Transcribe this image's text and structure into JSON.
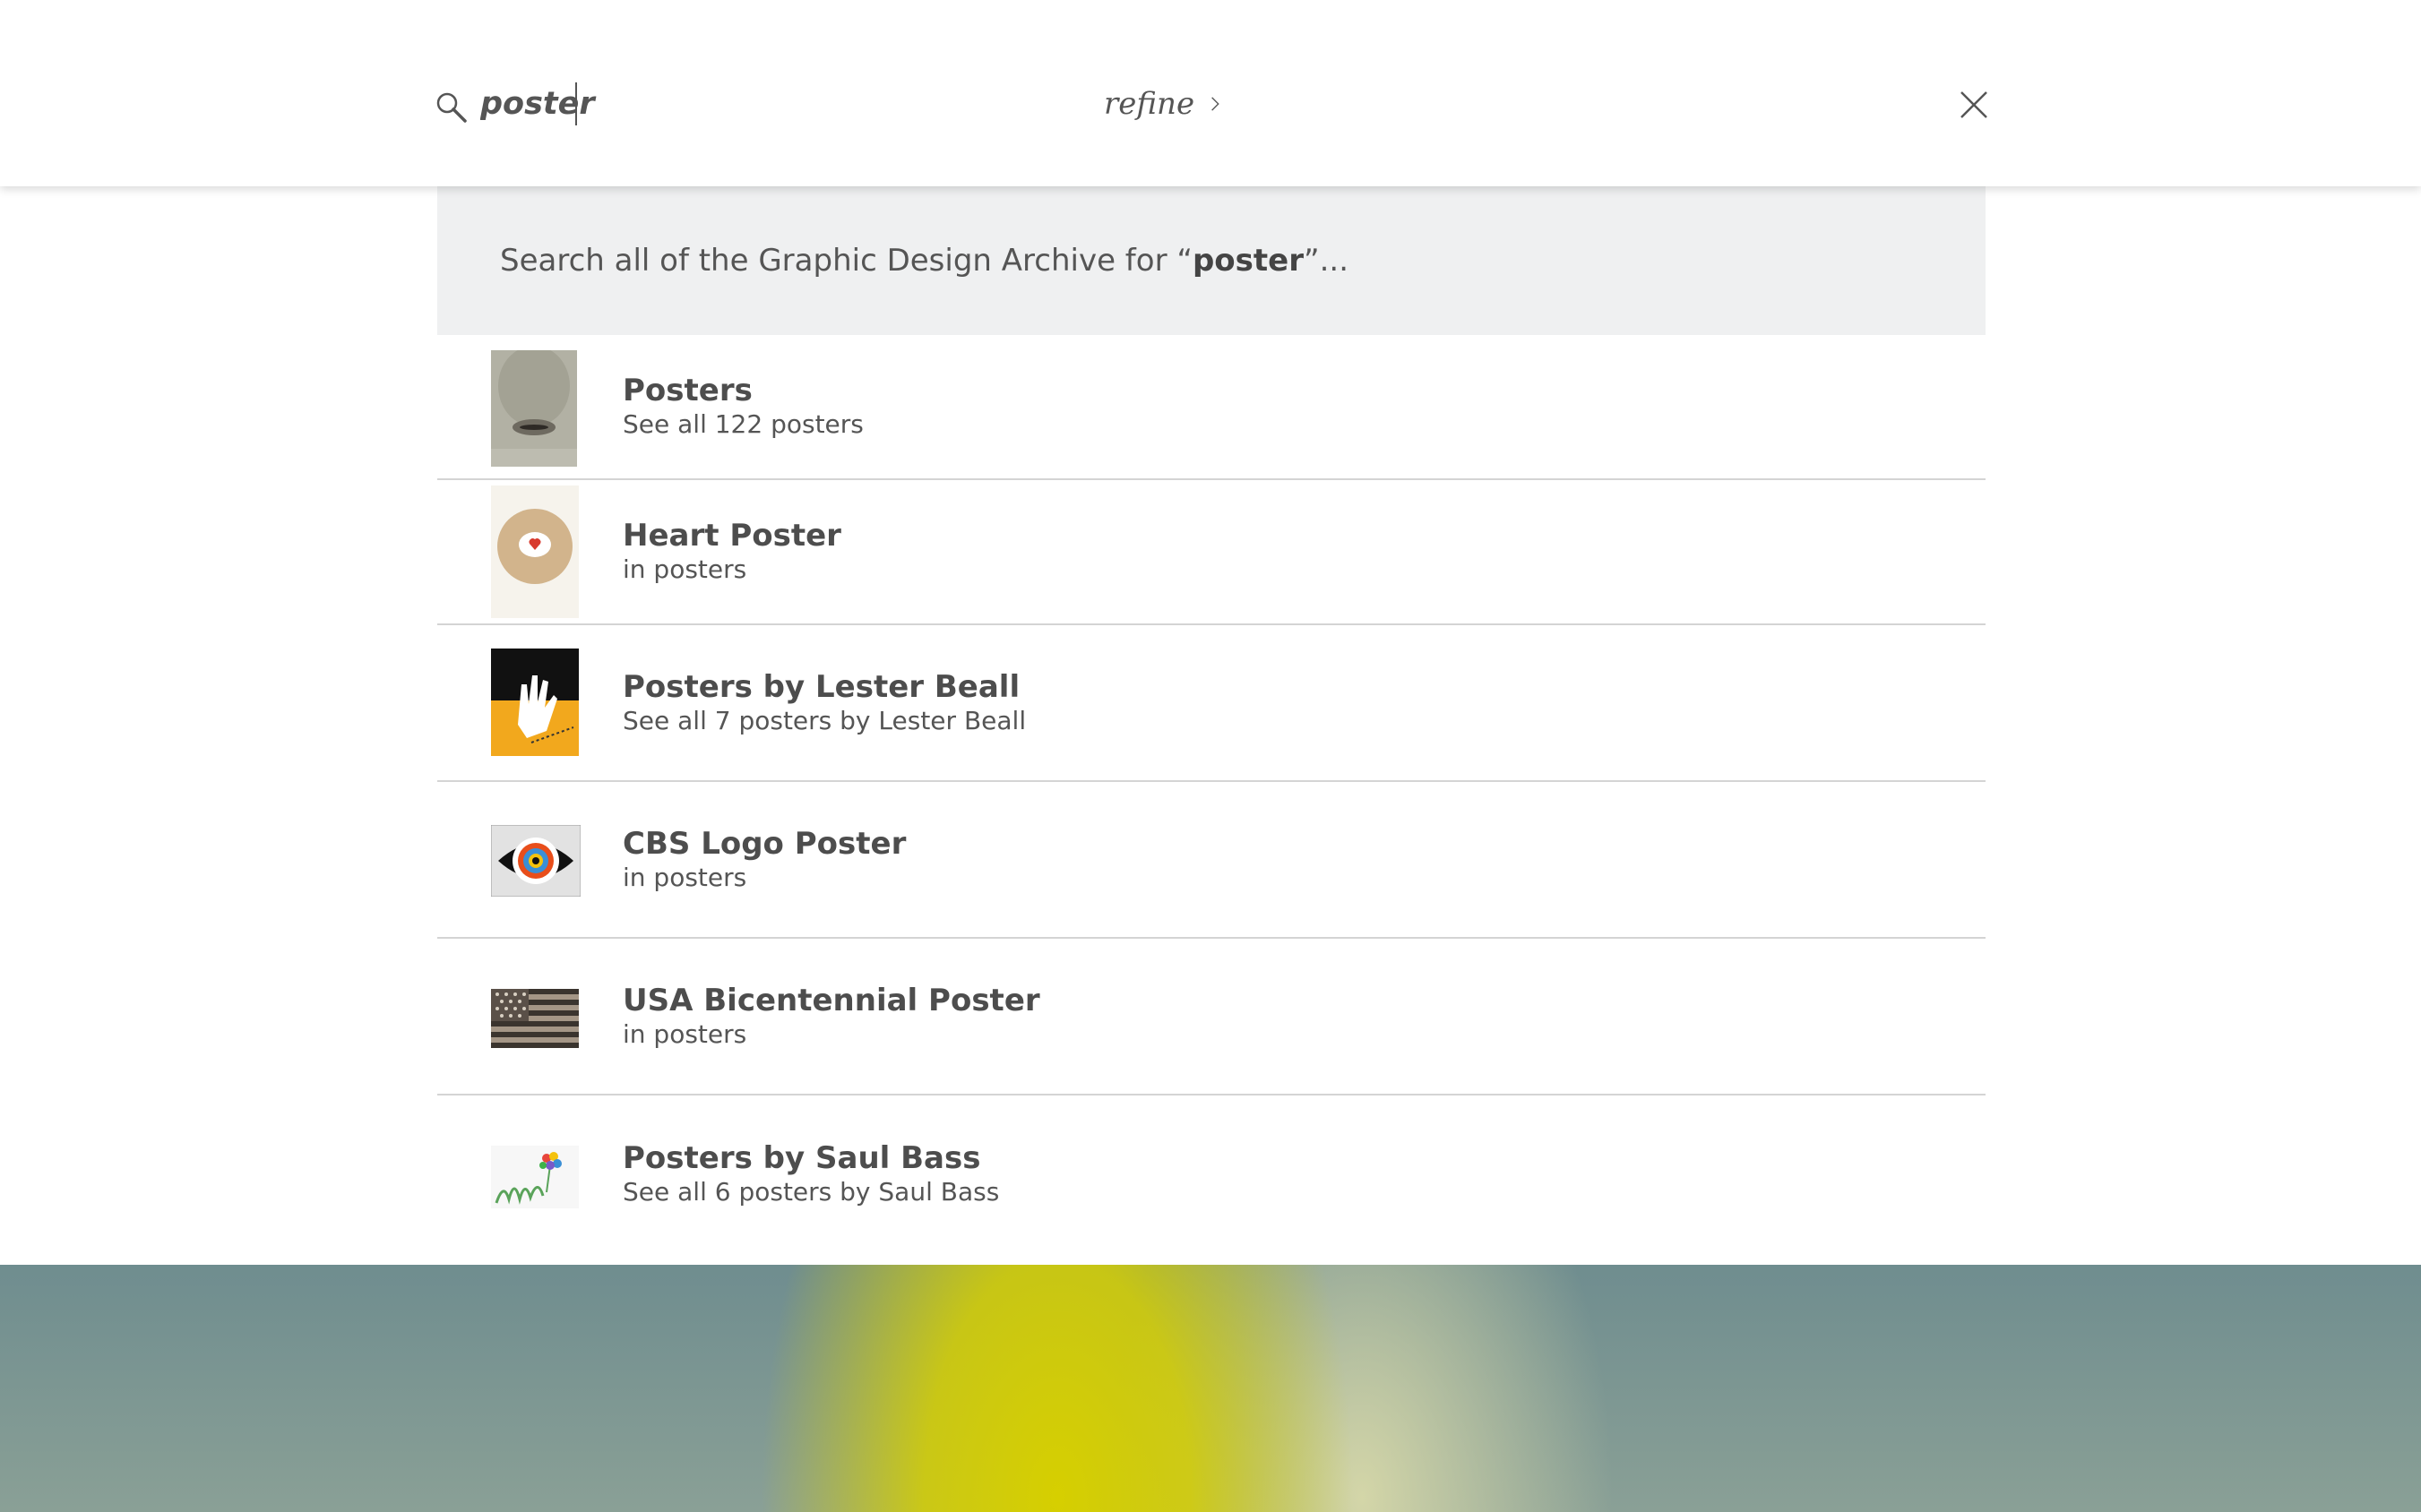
{
  "header": {
    "search_value": "poster",
    "refine_label": "refine"
  },
  "search_all": {
    "prefix": "Search all of the Graphic Design Archive for “",
    "query": "poster",
    "suffix": "”..."
  },
  "results": [
    {
      "title": "Posters",
      "subtitle": "See all 122 posters"
    },
    {
      "title": "Heart Poster",
      "subtitle": "in posters"
    },
    {
      "title": "Posters by Lester Beall",
      "subtitle": "See all 7 posters by Lester Beall"
    },
    {
      "title": "CBS Logo Poster",
      "subtitle": "in posters"
    },
    {
      "title": "USA Bicentennial Poster",
      "subtitle": "in posters"
    },
    {
      "title": "Posters by Saul Bass",
      "subtitle": "See all 6 posters by Saul Bass"
    }
  ],
  "icons": {
    "search": "search-icon",
    "refine": "chevron-right-icon",
    "close": "close-icon"
  },
  "colors": {
    "panel_bg": "#eff0f1",
    "text": "#555555",
    "divider": "#d4d4d4",
    "accent_yellow": "#d6cf00"
  }
}
